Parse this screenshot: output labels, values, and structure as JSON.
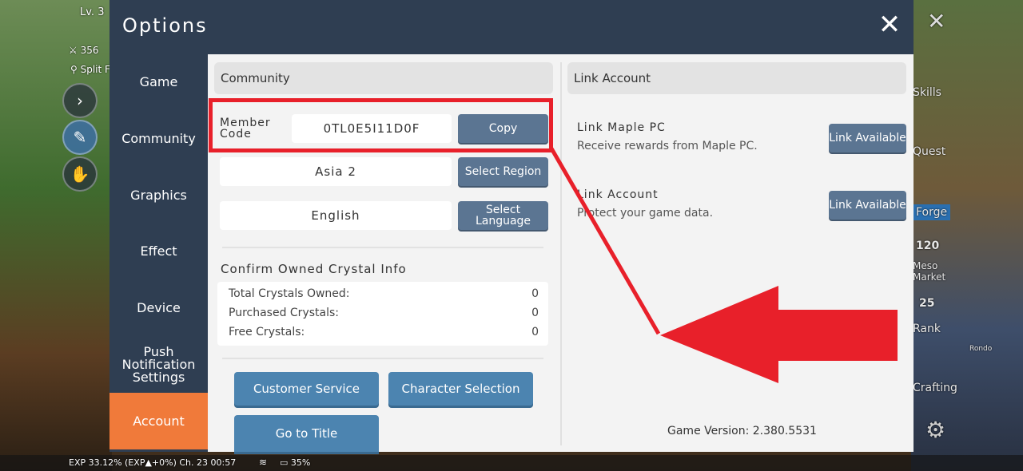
{
  "hud": {
    "level": "Lv. 3",
    "power": "356",
    "map": "Split F",
    "exp_bar": "EXP 33.12% (EXP▲+0%) Ch. 23 00:57",
    "battery": "35%",
    "right_items": [
      "Skills",
      "Quest",
      "Forge",
      "120",
      "Meso Market",
      "25",
      "Rank",
      "Crafting",
      "Rondo"
    ]
  },
  "window": {
    "title": "Options",
    "close_glyph": "✕"
  },
  "sidebar": {
    "items": [
      {
        "label": "Game"
      },
      {
        "label": "Community"
      },
      {
        "label": "Graphics"
      },
      {
        "label": "Effect"
      },
      {
        "label": "Device"
      },
      {
        "label": "Push Notification Settings"
      },
      {
        "label": "Account",
        "active": true
      }
    ]
  },
  "community": {
    "header": "Community",
    "member_code_label": "Member Code",
    "member_code": "0TL0E5I11D0F",
    "copy_label": "Copy",
    "region_value": "Asia 2",
    "region_button": "Select Region",
    "language_value": "English",
    "language_button": "Select Language",
    "crystal_title": "Confirm Owned Crystal Info",
    "crystals": [
      {
        "label": "Total Crystals Owned:",
        "value": "0"
      },
      {
        "label": "Purchased Crystals:",
        "value": "0"
      },
      {
        "label": "Free Crystals:",
        "value": "0"
      }
    ],
    "customer_service": "Customer Service",
    "character_selection": "Character Selection",
    "go_to_title": "Go to Title"
  },
  "link": {
    "header": "Link Account",
    "maple_title": "Link Maple PC",
    "maple_sub": "Receive rewards from Maple PC.",
    "maple_button": "Link Available",
    "account_title": "Link Account",
    "account_sub": "Protect your game data.",
    "account_button": "Link Available",
    "version": "Game Version: 2.380.5531"
  },
  "colors": {
    "panel": "#2f3e52",
    "active_tab": "#f07a3a",
    "annotation": "#e8202a"
  }
}
